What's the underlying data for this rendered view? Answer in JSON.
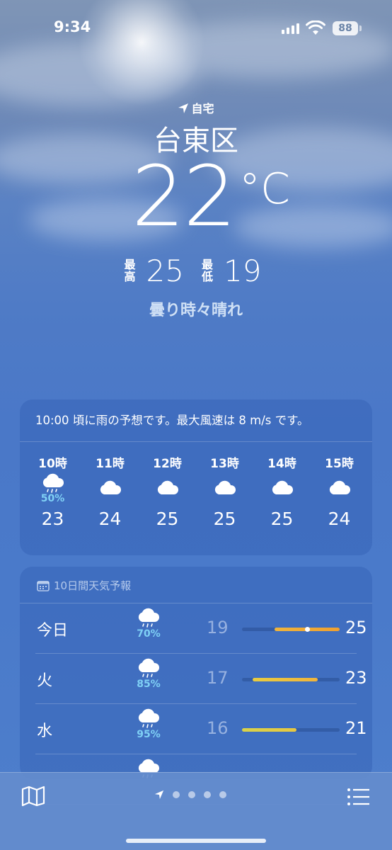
{
  "status_bar": {
    "time": "9:34",
    "battery": "88"
  },
  "header": {
    "location_tag": "自宅",
    "city": "台東区",
    "temperature": "22",
    "unit": "°C",
    "high_label": "最高",
    "high": "25",
    "low_label": "最低",
    "low": "19",
    "condition": "曇り時々晴れ"
  },
  "hourly": {
    "summary": "10:00 頃に雨の予想です。最大風速は 8 m/s です。",
    "items": [
      {
        "label": "10時",
        "icon": "rain-cloud-icon",
        "pop": "50%",
        "temp": "23"
      },
      {
        "label": "11時",
        "icon": "cloud-icon",
        "pop": "",
        "temp": "24"
      },
      {
        "label": "12時",
        "icon": "cloud-icon",
        "pop": "",
        "temp": "25"
      },
      {
        "label": "13時",
        "icon": "cloud-icon",
        "pop": "",
        "temp": "25"
      },
      {
        "label": "14時",
        "icon": "cloud-icon",
        "pop": "",
        "temp": "25"
      },
      {
        "label": "15時",
        "icon": "cloud-icon",
        "pop": "",
        "temp": "24"
      }
    ]
  },
  "daily": {
    "title": "10日間天気予報",
    "range_min": 16,
    "range_max": 25,
    "days": [
      {
        "name": "今日",
        "icon": "rain-cloud-icon",
        "pop": "70%",
        "low": "19",
        "high": "25",
        "current": 22,
        "color_from": "#f0b43c",
        "color_to": "#f0a030"
      },
      {
        "name": "火",
        "icon": "rain-cloud-icon",
        "pop": "85%",
        "low": "17",
        "high": "23",
        "color_from": "#e8cc40",
        "color_to": "#f0b43c"
      },
      {
        "name": "水",
        "icon": "rain-cloud-icon",
        "pop": "95%",
        "low": "16",
        "high": "21",
        "color_from": "#d8d24a",
        "color_to": "#e8c840"
      },
      {
        "name": "",
        "icon": "rain-cloud-icon",
        "pop": "",
        "low": "",
        "high": ""
      }
    ]
  },
  "colors": {
    "pop": "#7fd0f5",
    "accent_bar": "#f0b43c"
  }
}
